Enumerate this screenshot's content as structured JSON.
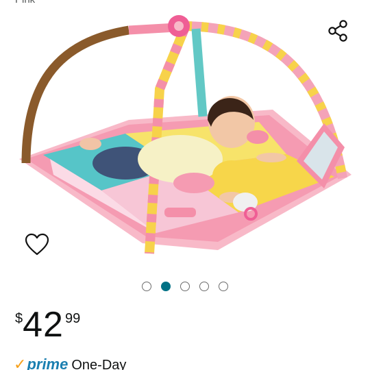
{
  "header": {
    "variant_label_cut": "Pink"
  },
  "carousel": {
    "count": 5,
    "active_index": 1
  },
  "price": {
    "symbol": "$",
    "whole": "42",
    "fraction": "99"
  },
  "delivery": {
    "check": "✓",
    "prime": "prime",
    "speed": "One-Day"
  },
  "colors": {
    "accent": "#007185",
    "prime_blue": "#1b7fb0",
    "prime_check": "#f6a01a",
    "text": "#0f1111"
  }
}
